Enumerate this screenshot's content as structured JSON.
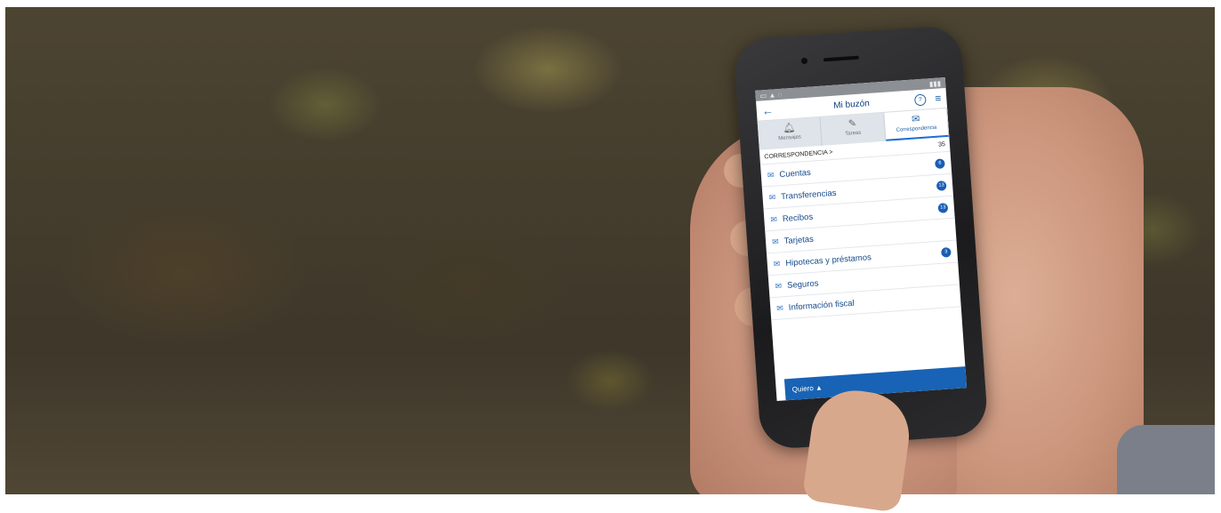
{
  "phone_app": {
    "header": {
      "title": "Mi buzón",
      "back_icon": "arrow-left-icon",
      "help_icon": "help-circle-icon",
      "menu_icon": "hamburger-menu-icon"
    },
    "tabs": [
      {
        "label": "Mensajes",
        "icon": "bell-icon",
        "active": false
      },
      {
        "label": "Tareas",
        "icon": "edit-icon",
        "active": false
      },
      {
        "label": "Correspondencia",
        "icon": "envelope-icon",
        "active": true
      }
    ],
    "section": {
      "label": "CORRESPONDENCIA  >",
      "count": "35"
    },
    "items": [
      {
        "label": "Cuentas",
        "badge": "6"
      },
      {
        "label": "Transferencias",
        "badge": "13"
      },
      {
        "label": "Recibos",
        "badge": "13"
      },
      {
        "label": "Tarjetas",
        "badge": ""
      },
      {
        "label": "Hipotecas y préstamos",
        "badge": "3"
      },
      {
        "label": "Seguros",
        "badge": ""
      },
      {
        "label": "Información fiscal",
        "badge": ""
      }
    ],
    "footer": {
      "label": "Quiero  ▲"
    }
  },
  "colors": {
    "accent": "#1863b5",
    "badge": "#1a5eb5",
    "link_text": "#164a8a"
  }
}
